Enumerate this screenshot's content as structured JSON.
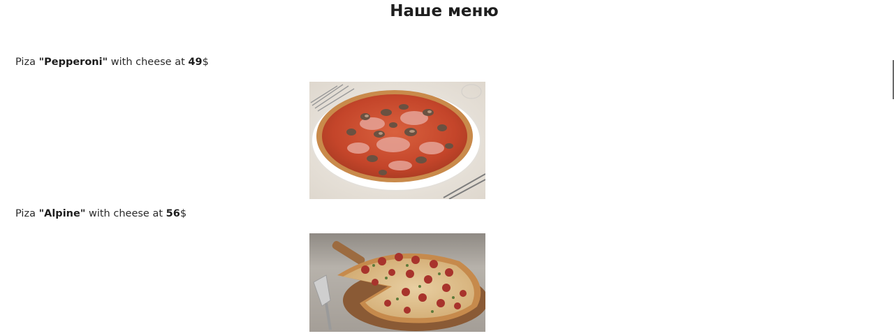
{
  "page": {
    "title": "Наше меню"
  },
  "menu": {
    "items": [
      {
        "prefix": "Piza ",
        "name": "\"Pepperoni\"",
        "middle": " with cheese at ",
        "price": "49",
        "currency": "$",
        "image_alt": "pepperoni-pizza-photo"
      },
      {
        "prefix": "Piza ",
        "name": "\"Alpine\"",
        "middle": " with cheese at ",
        "price": "56",
        "currency": "$",
        "image_alt": "alpine-pizza-photo"
      }
    ]
  },
  "colors": {
    "text": "#2b2b2b",
    "background": "#ffffff",
    "crust": "#c98a4b",
    "sauce": "#c0392b",
    "board": "#8a5a35"
  }
}
